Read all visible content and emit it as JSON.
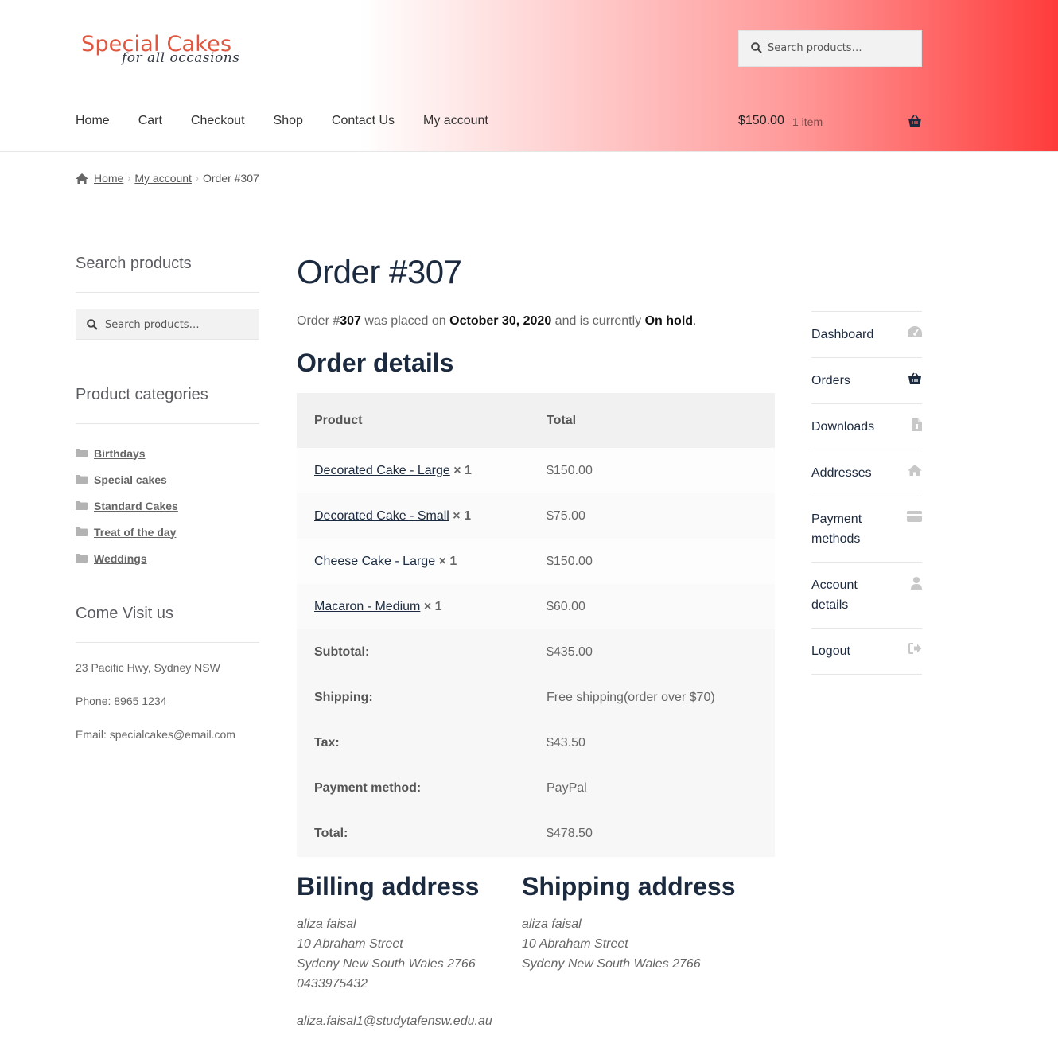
{
  "site": {
    "logo_line1": "Special Cakes",
    "logo_line2": "for all occasions",
    "header_search_placeholder": "Search products…",
    "accent_color": "#ff3b3b"
  },
  "nav": {
    "items": [
      "Home",
      "Cart",
      "Checkout",
      "Shop",
      "Contact Us",
      "My account"
    ]
  },
  "cart": {
    "amount": "$150.00",
    "count": "1 item",
    "icon": "basket-icon"
  },
  "breadcrumb": {
    "home": "Home",
    "my_account": "My account",
    "current": "Order #307"
  },
  "sidebar": {
    "search_title": "Search products",
    "search_placeholder": "Search products…",
    "categories_title": "Product categories",
    "categories": [
      "Birthdays",
      "Special cakes",
      "Standard Cakes",
      "Treat of the day",
      "Weddings"
    ],
    "visit_title": "Come Visit us",
    "visit_lines": [
      "23 Pacific Hwy, Sydney NSW",
      "Phone: 8965 1234",
      "Email: specialcakes@email.com"
    ]
  },
  "order": {
    "title": "Order #307",
    "intro_prefix": "Order #",
    "number": "307",
    "intro_mid": " was placed on ",
    "date": "October 30, 2020",
    "intro_mid2": " and is currently ",
    "status": "On hold",
    "intro_end": ".",
    "details_title": "Order details",
    "col_product": "Product",
    "col_total": "Total",
    "items": [
      {
        "name": "Decorated Cake - Large",
        "qty": "× 1",
        "total": "$150.00"
      },
      {
        "name": "Decorated Cake - Small",
        "qty": "× 1",
        "total": "$75.00"
      },
      {
        "name": "Cheese Cake - Large",
        "qty": "× 1",
        "total": "$150.00"
      },
      {
        "name": "Macaron - Medium",
        "qty": "× 1",
        "total": "$60.00"
      }
    ],
    "totals": [
      {
        "label": "Subtotal:",
        "value": "$435.00"
      },
      {
        "label": "Shipping:",
        "value": "Free shipping(order over $70)"
      },
      {
        "label": "Tax:",
        "value": "$43.50"
      },
      {
        "label": "Payment method:",
        "value": "PayPal"
      },
      {
        "label": "Total:",
        "value": "$478.50"
      }
    ]
  },
  "billing": {
    "title": "Billing address",
    "lines": [
      "aliza faisal",
      "10 Abraham Street",
      "Sydeny New South Wales 2766",
      "0433975432"
    ],
    "email": "aliza.faisal1@studytafensw.edu.au"
  },
  "shipping": {
    "title": "Shipping address",
    "lines": [
      "aliza faisal",
      "10 Abraham Street",
      "Sydeny New South Wales 2766"
    ]
  },
  "account_nav": [
    {
      "label": "Dashboard",
      "icon": "dashboard-icon"
    },
    {
      "label": "Orders",
      "icon": "basket-icon"
    },
    {
      "label": "Downloads",
      "icon": "file-icon"
    },
    {
      "label": "Addresses",
      "icon": "home-icon"
    },
    {
      "label": "Payment methods",
      "icon": "credit-card-icon"
    },
    {
      "label": "Account details",
      "icon": "user-icon"
    },
    {
      "label": "Logout",
      "icon": "sign-out-icon"
    }
  ]
}
